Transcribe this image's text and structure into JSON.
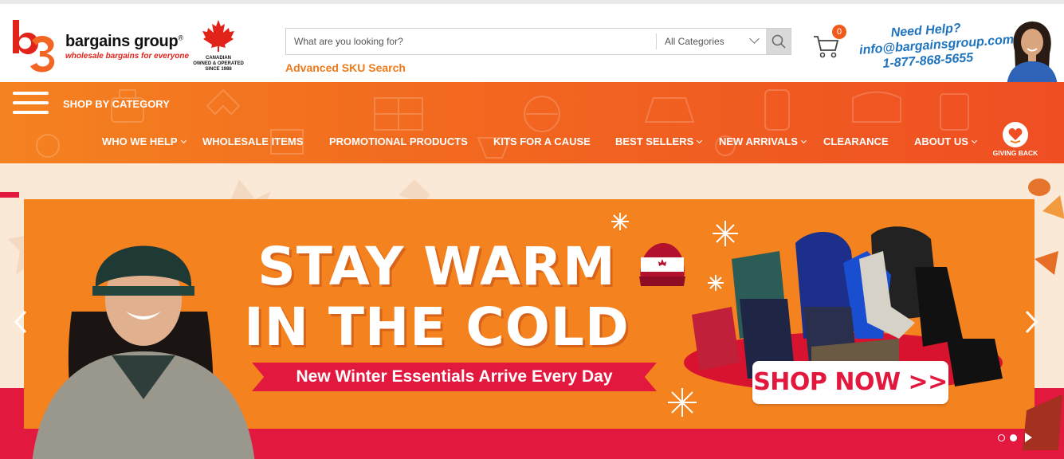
{
  "brand": {
    "name": "bargains group",
    "registered": "®",
    "tagline": "wholesale bargains for everyone",
    "canada_badge": [
      "CANADIAN",
      "OWNED & OPERATED",
      "SINCE 1988"
    ]
  },
  "search": {
    "placeholder": "What are you looking for?",
    "category": "All Categories",
    "advanced_link": "Advanced SKU Search"
  },
  "cart": {
    "count": "0"
  },
  "help": {
    "title": "Need Help?",
    "email": "info@bargainsgroup.com",
    "phone": "1-877-868-5655"
  },
  "nav": {
    "shop_by_category": "SHOP BY CATEGORY",
    "items": [
      {
        "label": "WHO WE HELP",
        "dropdown": true
      },
      {
        "label": "WHOLESALE ITEMS",
        "dropdown": false
      },
      {
        "label": "PROMOTIONAL PRODUCTS",
        "dropdown": false
      },
      {
        "label": "KITS FOR A CAUSE",
        "dropdown": false
      },
      {
        "label": "BEST SELLERS",
        "dropdown": true
      },
      {
        "label": "NEW ARRIVALS",
        "dropdown": true
      },
      {
        "label": "CLEARANCE",
        "dropdown": false
      },
      {
        "label": "ABOUT US",
        "dropdown": true
      }
    ],
    "giving_back": "GIVING BACK"
  },
  "hero": {
    "headline_line1": "STAY WARM",
    "headline_line2": "IN THE COLD",
    "ribbon": "New Winter Essentials Arrive Every Day",
    "cta": "SHOP NOW >>",
    "slides_total": 2,
    "slide_active": 2
  },
  "colors": {
    "nav_orange": "#f26a1f",
    "accent_red": "#e2183e",
    "link_orange": "#f07a1a",
    "help_blue": "#1e73be",
    "hero_bg": "#fbe9d8"
  }
}
